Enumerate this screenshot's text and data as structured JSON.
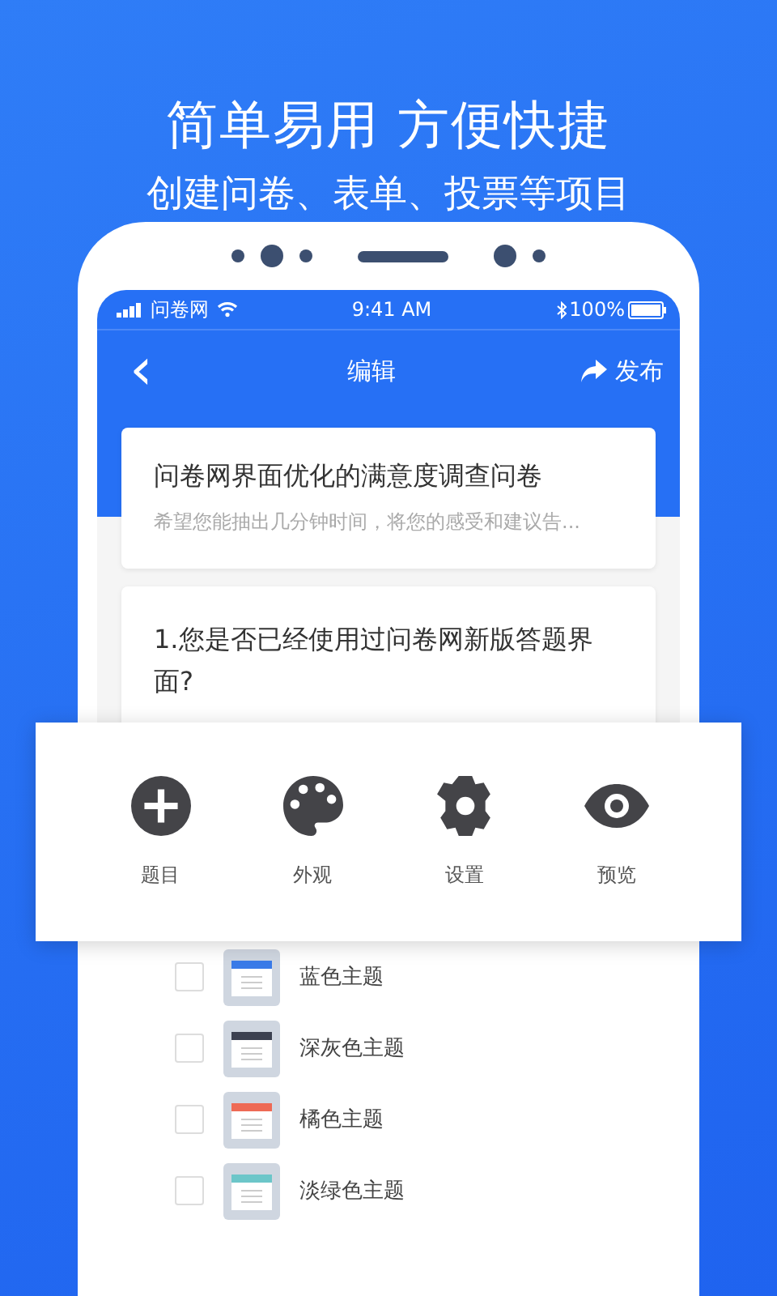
{
  "headline": "简单易用 方便快捷",
  "subheadline": "创建问卷、表单、投票等项目",
  "status_bar": {
    "carrier": "问卷网",
    "time": "9:41 AM",
    "battery": "100%"
  },
  "nav": {
    "back": "‹",
    "title": "编辑",
    "action": "发布"
  },
  "survey": {
    "title": "问卷网界面优化的满意度调查问卷",
    "description": "希望您能抽出几分钟时间，将您的感受和建议告..."
  },
  "question": {
    "text": "1.您是否已经使用过问卷网新版答题界面?"
  },
  "toolbar": [
    {
      "kind": "add",
      "label": "题目"
    },
    {
      "kind": "palette",
      "label": "外观"
    },
    {
      "kind": "gear",
      "label": "设置"
    },
    {
      "kind": "eye",
      "label": "预览"
    }
  ],
  "themes": [
    {
      "label": "蓝色主题",
      "color": "#3a7be8",
      "checked": false
    },
    {
      "label": "深灰色主题",
      "color": "#3c4150",
      "checked": false
    },
    {
      "label": "橘色主题",
      "color": "#ee6a55",
      "checked": false
    },
    {
      "label": "淡绿色主题",
      "color": "#6cc6c9",
      "checked": false
    }
  ]
}
